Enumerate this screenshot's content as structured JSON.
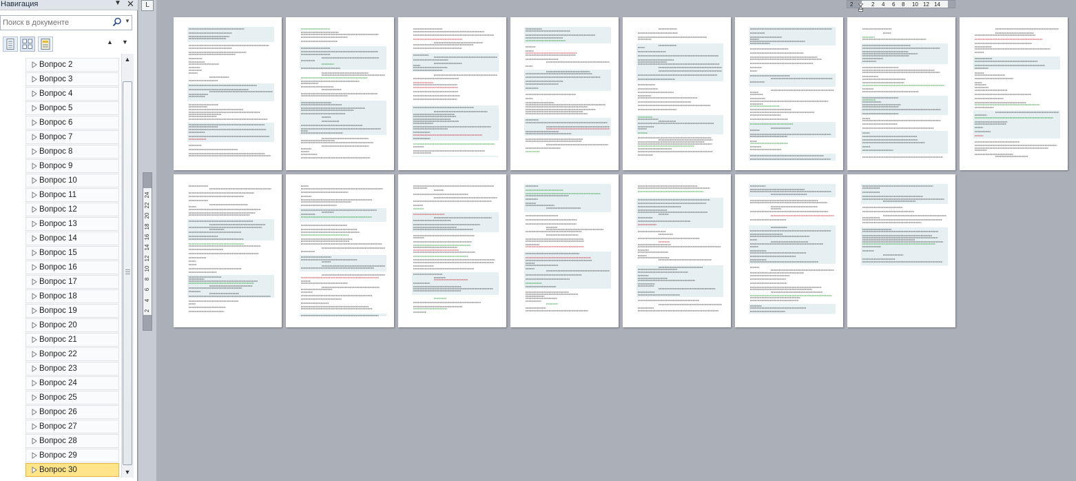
{
  "nav_pane": {
    "title": "Навигация",
    "search": {
      "placeholder": "Поиск в документе"
    },
    "view_buttons": [
      "headings-view",
      "pages-view",
      "results-view"
    ],
    "headings": [
      {
        "label": "Вопрос 2"
      },
      {
        "label": "Вопрос 3"
      },
      {
        "label": "Вопрос 4"
      },
      {
        "label": "Вопрос 5"
      },
      {
        "label": "Вопрос 6"
      },
      {
        "label": "Вопрос 7"
      },
      {
        "label": "Вопрос 8"
      },
      {
        "label": "Вопрос 9"
      },
      {
        "label": "Вопрос 10"
      },
      {
        "label": "Вопрос 11"
      },
      {
        "label": "Вопрос 12"
      },
      {
        "label": "Вопрос 13"
      },
      {
        "label": "Вопрос 14"
      },
      {
        "label": "Вопрос 15"
      },
      {
        "label": "Вопрос 16"
      },
      {
        "label": "Вопрос 17"
      },
      {
        "label": "Вопрос 18"
      },
      {
        "label": "Вопрос 19"
      },
      {
        "label": "Вопрос 20"
      },
      {
        "label": "Вопрос 21"
      },
      {
        "label": "Вопрос 22"
      },
      {
        "label": "Вопрос 23"
      },
      {
        "label": "Вопрос 24"
      },
      {
        "label": "Вопрос 25"
      },
      {
        "label": "Вопрос 26"
      },
      {
        "label": "Вопрос 27"
      },
      {
        "label": "Вопрос 28"
      },
      {
        "label": "Вопрос 29"
      },
      {
        "label": "Вопрос 30",
        "selected": true
      }
    ]
  },
  "ruler": {
    "corner_glyph": "L",
    "horizontal_ticks": [
      "2",
      "2",
      "4",
      "6",
      "8",
      "10",
      "12",
      "14"
    ],
    "vertical_ticks": [
      "2",
      "4",
      "6",
      "8",
      "10",
      "12",
      "14",
      "16",
      "18",
      "20",
      "22",
      "24"
    ]
  },
  "document": {
    "page_count": 15,
    "pages_per_row": 8
  },
  "colors": {
    "workspace": "#abafb8",
    "selected_heading": "#ffe48a",
    "shaded_block": "#e6f0f2",
    "text_line": "#4a4a4a",
    "highlight_green": "#2e9a3a",
    "highlight_red": "#c8323c"
  }
}
